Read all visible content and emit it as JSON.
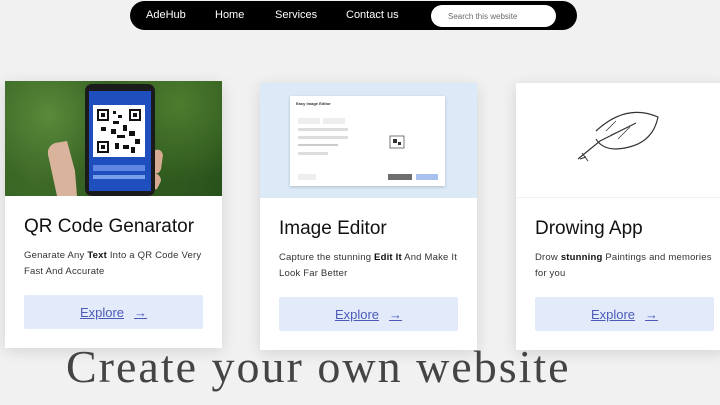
{
  "nav": {
    "brand": "AdeHub",
    "links": [
      "Home",
      "Services",
      "Contact us"
    ],
    "search_placeholder": "Search this website"
  },
  "cards": [
    {
      "title": "QR Code Genarator",
      "desc_pre": "Genarate Any ",
      "desc_bold": "Text",
      "desc_post": " Into a QR Code Very Fast And Accurate",
      "button": "Explore",
      "arrow": "→",
      "image_icon": "qr-phone-photo"
    },
    {
      "title": "Image Editor",
      "desc_pre": "Capture the stunning ",
      "desc_bold": "Edit It",
      "desc_post": " And Make It Look Far Better",
      "button": "Explore",
      "arrow": "→",
      "image_icon": "image-editor-preview",
      "preview_title": "Easy Image Editor"
    },
    {
      "title": "Drowing App",
      "desc_pre": "Drow ",
      "desc_bold": "stunning",
      "desc_post": " Paintings and memories for you",
      "button": "Explore",
      "arrow": "→",
      "image_icon": "leaf-sketch-icon"
    }
  ],
  "caption": "Create your own website",
  "colors": {
    "navbar": "#000000",
    "button_bg": "#e3ebfb",
    "button_text": "#4b5ab9",
    "editor_bg": "#dceaf8"
  }
}
